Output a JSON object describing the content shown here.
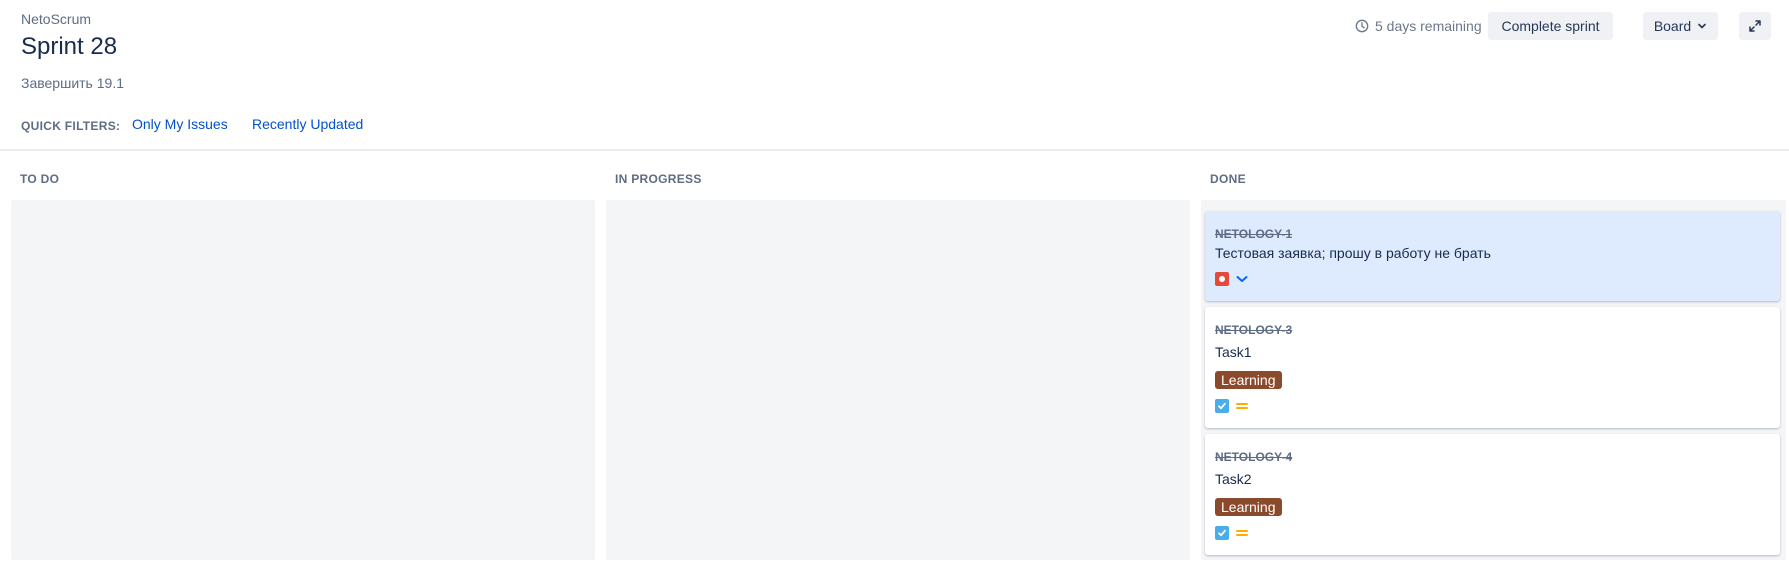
{
  "header": {
    "project": "NetoScrum",
    "title": "Sprint 28",
    "goal": "Завершить 19.1"
  },
  "toolbar": {
    "remaining": "5 days remaining",
    "complete_sprint": "Complete sprint",
    "board": "Board",
    "icons": {
      "clock": "clock-icon",
      "chevron": "chevron-down-icon",
      "expand": "expand-icon"
    }
  },
  "quick_filters": {
    "label": "QUICK FILTERS:",
    "items": [
      "Only My Issues",
      "Recently Updated"
    ]
  },
  "columns": [
    "TO DO",
    "IN PROGRESS",
    "DONE"
  ],
  "done_cards": [
    {
      "key": "NETOLOGY-1",
      "summary": "Тестовая заявка; прошу в работу не брать",
      "type": "bug",
      "priority": "low",
      "selected": true
    },
    {
      "key": "NETOLOGY-3",
      "summary": "Task1",
      "label": "Learning",
      "type": "task",
      "priority": "medium"
    },
    {
      "key": "NETOLOGY-4",
      "summary": "Task2",
      "label": "Learning",
      "type": "task",
      "priority": "medium"
    }
  ],
  "colors": {
    "link": "#0052cc",
    "label_bg": "#8b4a2b",
    "selected_card": "#deebff",
    "priority_medium": "#ffab00",
    "priority_low": "#0065ff"
  }
}
